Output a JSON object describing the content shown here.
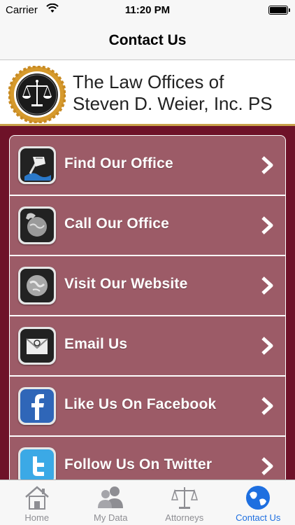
{
  "status_bar": {
    "carrier": "Carrier",
    "time": "11:20 PM"
  },
  "nav": {
    "title": "Contact Us"
  },
  "header": {
    "line1": "The Law Offices of",
    "line2": "Steven D. Weier, Inc. PS",
    "logo_icon": "scales-of-justice-seal-icon"
  },
  "menu": {
    "items": [
      {
        "label": "Find Our Office",
        "icon": "map-pin-icon"
      },
      {
        "label": "Call Our Office",
        "icon": "phone-globe-icon"
      },
      {
        "label": "Visit Our Website",
        "icon": "globe-icon"
      },
      {
        "label": "Email Us",
        "icon": "email-icon"
      },
      {
        "label": "Like Us On Facebook",
        "icon": "facebook-icon"
      },
      {
        "label": "Follow Us On Twitter",
        "icon": "twitter-icon"
      }
    ]
  },
  "tabs": [
    {
      "label": "Home",
      "icon": "house-icon",
      "active": false
    },
    {
      "label": "My Data",
      "icon": "people-icon",
      "active": false
    },
    {
      "label": "Attorneys",
      "icon": "scales-icon",
      "active": false
    },
    {
      "label": "Contact Us",
      "icon": "globe-icon",
      "active": true
    }
  ],
  "colors": {
    "background": "#6e1228",
    "menu_item": "#9c5b67",
    "active_tab": "#1e6fe0",
    "seal_gold": "#d69a2d"
  }
}
